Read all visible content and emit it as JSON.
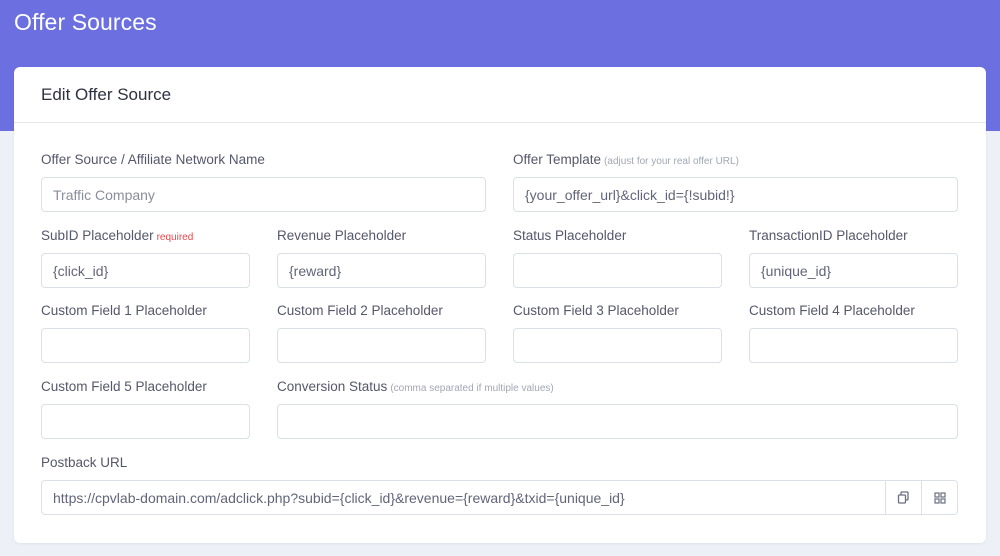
{
  "page": {
    "title": "Offer Sources"
  },
  "card": {
    "title": "Edit Offer Source"
  },
  "fields": {
    "network_name": {
      "label": "Offer Source / Affiliate Network Name",
      "placeholder": "Traffic Company"
    },
    "offer_template": {
      "label": "Offer Template",
      "hint": "(adjust for your real offer URL)",
      "value": "{your_offer_url}&click_id={!subid!}"
    },
    "subid": {
      "label": "SubID Placeholder",
      "required": "required",
      "value": "{click_id}"
    },
    "revenue": {
      "label": "Revenue Placeholder",
      "value": "{reward}"
    },
    "status": {
      "label": "Status Placeholder",
      "value": ""
    },
    "transaction": {
      "label": "TransactionID Placeholder",
      "value": "{unique_id}"
    },
    "custom1": {
      "label": "Custom Field 1 Placeholder",
      "value": ""
    },
    "custom2": {
      "label": "Custom Field 2 Placeholder",
      "value": ""
    },
    "custom3": {
      "label": "Custom Field 3 Placeholder",
      "value": ""
    },
    "custom4": {
      "label": "Custom Field 4 Placeholder",
      "value": ""
    },
    "custom5": {
      "label": "Custom Field 5 Placeholder",
      "value": ""
    },
    "conversion_status": {
      "label": "Conversion Status",
      "hint": "(comma separated if multiple values)",
      "value": ""
    },
    "postback": {
      "label": "Postback URL",
      "value": "https://cpvlab-domain.com/adclick.php?subid={click_id}&revenue={reward}&txid={unique_id}"
    }
  },
  "icons": {
    "copy": "copy-icon",
    "qr": "qr-code-icon"
  },
  "colors": {
    "header": "#6b6fe0",
    "required": "#e5484d"
  }
}
